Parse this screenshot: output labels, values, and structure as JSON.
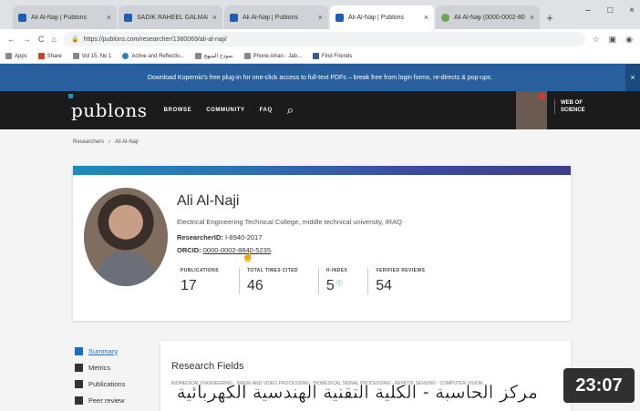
{
  "browser": {
    "tabs": [
      {
        "title": "Ali Al-Naji | Publons",
        "icon": "publons-favicon"
      },
      {
        "title": "SADIK RAHEEL GALMARGANI ...",
        "icon": "publons-favicon"
      },
      {
        "title": "Ali Al-Naji | Publons",
        "icon": "publons-favicon"
      },
      {
        "title": "Ali Al-Naji | Publons",
        "icon": "publons-favicon"
      },
      {
        "title": "Ali Al-Naji (0000-0002-80+",
        "icon": "orcid-favicon"
      }
    ],
    "close_glyph": "×",
    "new_tab_glyph": "+",
    "window_controls": [
      "–",
      "□",
      "×"
    ],
    "nav_glyphs": [
      "←",
      "→",
      "C",
      "⌂"
    ],
    "url": "https://publons.com/researcher/1380069/ali-al-naji/",
    "addr_icons": [
      "☆",
      "▣",
      "◉"
    ],
    "bookmarks": [
      "Apps",
      "Share",
      "Vol 15, No 1",
      "Active and Reflectiv...",
      "نموذج المنهج",
      "Phone.ishan - Jab...",
      "Find Friends"
    ]
  },
  "banner": {
    "text": "Download Kopernio's free plug-in for one-click access to full-text PDFs – break free from login forms, re-directs & pop-ups.",
    "close": "×"
  },
  "header": {
    "logo": "publons",
    "nav": [
      "BROWSE",
      "COMMUNITY",
      "FAQ"
    ],
    "search_glyph": "⌕",
    "wos_line1": "WEB OF",
    "wos_line2": "SCIENCE"
  },
  "breadcrumb": {
    "items": [
      "Researchers",
      "Ali Al-Naji"
    ],
    "separator": "›"
  },
  "profile": {
    "name": "Ali Al-Naji",
    "institution": "Electrical Engineering Technical College, middle technical university, IRAQ",
    "researcher_id_label": "ResearcherID:",
    "researcher_id": "I-8940-2017",
    "orcid_label": "ORCID:",
    "orcid": "0000-0002-8840-5235",
    "stats": [
      {
        "label": "PUBLICATIONS",
        "value": "17"
      },
      {
        "label": "TOTAL TIMES CITED",
        "value": "46"
      },
      {
        "label": "H-INDEX",
        "value": "5"
      },
      {
        "label": "VERIFIED REVIEWS",
        "value": "54"
      }
    ],
    "info_glyph": "ⓘ"
  },
  "sidenav": [
    {
      "label": "Summary",
      "active": true
    },
    {
      "label": "Metrics",
      "active": false
    },
    {
      "label": "Publications",
      "active": false
    },
    {
      "label": "Peer review",
      "active": false
    }
  ],
  "research_fields": {
    "title": "Research Fields",
    "tags": "BIOMEDICAL ENGINEERING  ·  IMAGE AND VIDEO PROCESSING  ·  BIOMEDICAL SIGNAL PROCESSING  ·  REMOTE SENSING  ·  COMPUTER VISION"
  },
  "caption": "مركز الحاسبة - الكلية التقنية الهندسية الكهربائية",
  "duration": "23:07"
}
